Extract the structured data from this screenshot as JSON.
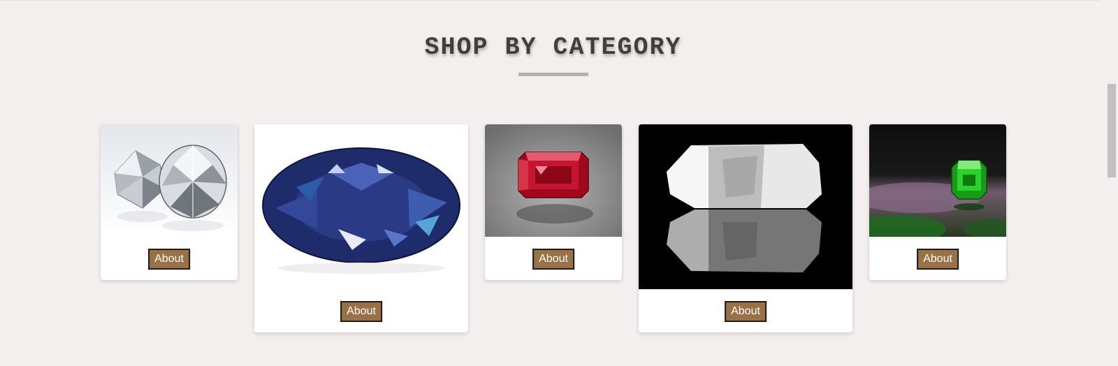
{
  "section": {
    "title": "SHOP BY CATEGORY"
  },
  "categories": [
    {
      "gem": "diamond",
      "button_label": "About"
    },
    {
      "gem": "sapphire",
      "button_label": "About"
    },
    {
      "gem": "ruby",
      "button_label": "About"
    },
    {
      "gem": "quartz",
      "button_label": "About"
    },
    {
      "gem": "emerald",
      "button_label": "About"
    }
  ],
  "colors": {
    "page_background": "#f4efef",
    "button_background": "#9a7047",
    "button_border": "#1b1b1b",
    "title_text": "#3f3f3f",
    "underline": "#b3b0b0"
  }
}
